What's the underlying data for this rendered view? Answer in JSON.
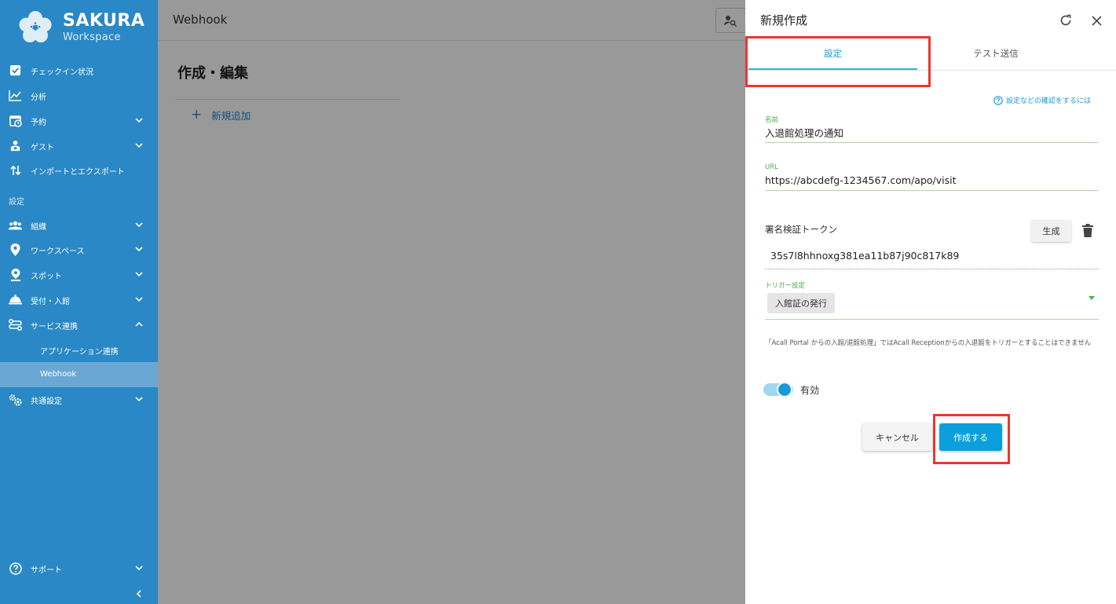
{
  "app": {
    "logo_title": "SAKURA",
    "logo_subtitle": "Workspace"
  },
  "sidebar": {
    "items": [
      {
        "label": "チェックイン状況",
        "icon": "checkbox-icon"
      },
      {
        "label": "分析",
        "icon": "chart-line-icon"
      },
      {
        "label": "予約",
        "icon": "calendar-clock-icon"
      },
      {
        "label": "ゲスト",
        "icon": "guest-icon"
      },
      {
        "label": "インポートとエクスポート",
        "icon": "import-export-icon"
      }
    ],
    "section_label": "設定",
    "settings_items": [
      {
        "label": "組織",
        "icon": "people-icon"
      },
      {
        "label": "ワークスペース",
        "icon": "map-pin-icon"
      },
      {
        "label": "スポット",
        "icon": "spot-pin-icon"
      },
      {
        "label": "受付・入館",
        "icon": "reception-bell-icon"
      },
      {
        "label": "サービス連携",
        "icon": "integration-icon"
      }
    ],
    "sub_items": [
      {
        "label": "アプリケーション連携"
      },
      {
        "label": "Webhook"
      }
    ],
    "common_settings": {
      "label": "共通設定",
      "icon": "gears-icon"
    },
    "support": {
      "label": "サポート",
      "icon": "help-circle-icon"
    }
  },
  "main": {
    "topbar_title": "Webhook",
    "page_heading": "作成・編集",
    "add_link_icon": "+",
    "add_link_label": "新規追加"
  },
  "drawer": {
    "title": "新規作成",
    "tabs": [
      {
        "label": "設定",
        "active": true
      },
      {
        "label": "テスト送信",
        "active": false
      }
    ],
    "help_link": "設定などの確認をするには",
    "name_label": "名前",
    "name_value": "入退館処理の通知",
    "url_label": "URL",
    "url_value": "https://abcdefg-1234567.com/apo/visit",
    "token_label": "署名検証トークン",
    "generate_button": "生成",
    "token_value": "35s7l8hhnoxg381ea11b87j90c817k89",
    "trigger_label": "トリガー設定",
    "trigger_value": "入館証の発行",
    "note": "「Acall Portal からの入館/退館処理」ではAcall Receptionからの入退館をトリガーとすることはできません",
    "toggle_label": "有効",
    "toggle_on": true,
    "cancel_button": "キャンセル",
    "create_button": "作成する"
  },
  "colors": {
    "sidebar_bg": "#2a88c6",
    "accent": "#1a9bd7",
    "primary_button": "#0c9fde",
    "field_label": "#4cae4c",
    "highlight": "#e8382f"
  }
}
